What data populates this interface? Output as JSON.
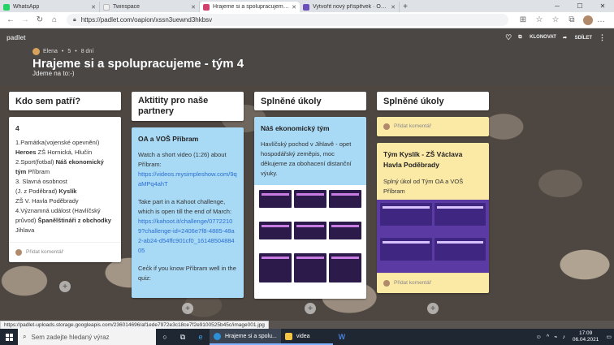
{
  "browser": {
    "tabs": [
      {
        "label": "WhatsApp",
        "color": "#25d366"
      },
      {
        "label": "Twinspace",
        "color": "#e0e0e0"
      },
      {
        "label": "Hrajeme si a spolupracujeme - tý",
        "color": "#d2416e"
      },
      {
        "label": "Vytvořit nový příspěvek · Obchod",
        "color": "#6b4fbb"
      }
    ],
    "url": "https://padlet.com/oapion/xssn3uewnd3hkbsv"
  },
  "padlet": {
    "logo": "padlet",
    "author": "Elena",
    "likes": "5",
    "age": "8 dní",
    "title": "Hrajeme si a spolupracujeme - tým 4",
    "subtitle": "Jdeme na to:-)",
    "clone_label": "KLONOVAT",
    "share_label": "SDÍLET"
  },
  "columns": [
    {
      "title": "Kdo sem patří?",
      "card": {
        "number": "4",
        "lines_a": [
          "1.Památka(vojenské opevnění)"
        ],
        "heroes_bold": "Heroes",
        "heroes_rest": " ZŠ Hornická, Hlučín",
        "sport": "2.Sport(fotbal) ",
        "sport_bold": "Náš ekonomický tým",
        "sport_rest": " Příbram",
        "person": "3. Slavná osobnost",
        "person2": "(J. z Poděbrad) ",
        "person2_bold": "Kyslík",
        "person3": "ZŠ V. Havla Poděbrady",
        "event": "4.Významná událost (Havlíčský průvod) ",
        "event_bold": "Španělštináři z obchodky",
        "event_rest": " Jihlava"
      },
      "comment": "Přidat komentář"
    },
    {
      "title": "Aktitity pro naše partnery",
      "card": {
        "title": "OA a VOŠ Příbram",
        "p1": "Watch a short video (1:26) about Příbram:",
        "link1": "https://videos.mysimpleshow.com/9qaMPq4ahT",
        "p2": "Take part in a Kahoot challenge, which is open till the end of March:",
        "link2": "https://kahoot.it/challenge/07722109?challenge-id=2406e7f8-4885-48a2-ab24-d54ffc901cf0_1614850488405",
        "p3": "Cec̓k if you know Příbram well in the quiz:"
      }
    },
    {
      "title": "Splněné úkoly",
      "card": {
        "title": "Náš ekonomický tým",
        "body": "Havlíčský pochod v Jihlavě - opet hospodářský zeměpis, moc děkujeme za obohacení distanční výuky."
      }
    },
    {
      "title": "Splněné úkoly",
      "top_comment": "Přidat komentář",
      "card": {
        "title": "Tým Kyslík - ZŠ Václava Havla Poděbrady",
        "body": "Splný úkol od Tým  OA a VOŠ Příbram"
      },
      "comment": "Přidat komentář"
    }
  ],
  "status_url": "https://padlet-uploads.storage.googleapis.com/236014696/af1ede7972e3c18ce7f2e9100525b45c/image001.jpg",
  "taskbar": {
    "search_placeholder": "Sem zadejte hledaný výraz",
    "tasks": [
      "Hrajeme si a spolu...",
      "videa"
    ],
    "time": "17:09",
    "date": "06.04.2021"
  }
}
